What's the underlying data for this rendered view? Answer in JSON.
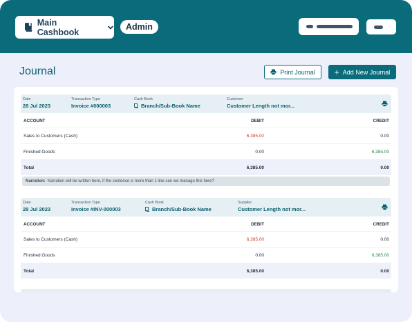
{
  "header": {
    "cashbook_label": "Main Cashbook",
    "role": "Admin"
  },
  "page": {
    "title": "Journal",
    "print_label": "Print Journal",
    "add_label": "Add New Journal"
  },
  "columns": {
    "account": "ACCOUNT",
    "debit": "DEBIT",
    "credit": "CREDIT"
  },
  "entries": [
    {
      "date_label": "Date",
      "date": "28 Jul 2023",
      "type_label": "Transaction Type",
      "type": "Invoice #000003",
      "cashbook_label": "Cash Book",
      "cashbook": "Branch/Sub-Book Name",
      "party_label": "Customer",
      "party": "Customer Length not mor...",
      "rows": [
        {
          "account": "Sales to Customers (Cash)",
          "debit": "6,385.00",
          "credit": "0.00"
        },
        {
          "account": "Finished Goods",
          "debit": "0.00",
          "credit": "6,385.00"
        }
      ],
      "total": {
        "label": "Total",
        "debit": "6,385.00",
        "credit": "0.00"
      },
      "narration_label": "Narration:",
      "narration": "Narration will be written here, if the sentence is more than 1 line can we manage this here?"
    },
    {
      "date_label": "Date",
      "date": "28 Jul 2023",
      "type_label": "Transaction Type",
      "type": "Invoice #INV-000003",
      "cashbook_label": "Cash Book",
      "cashbook": "Branch/Sub-Book Name",
      "party_label": "Supplier",
      "party": "Customer Length not mor...",
      "rows": [
        {
          "account": "Sales to Customers (Cash)",
          "debit": "6,385.00",
          "credit": "0.00"
        },
        {
          "account": "Finished Goods",
          "debit": "0.00",
          "credit": "6,385.00"
        }
      ],
      "total": {
        "label": "Total",
        "debit": "6,385.00",
        "credit": "0.00"
      }
    }
  ],
  "colors": {
    "brand": "#0a6b7b",
    "debit_text": "#d33a2c",
    "credit_text": "#1f8b4c",
    "background": "#edf0fa"
  },
  "icons": {
    "cashbook": "book-icon",
    "dropdown": "chevron-down-icon",
    "print": "printer-icon",
    "add": "plus-icon",
    "branch": "branch-icon"
  }
}
